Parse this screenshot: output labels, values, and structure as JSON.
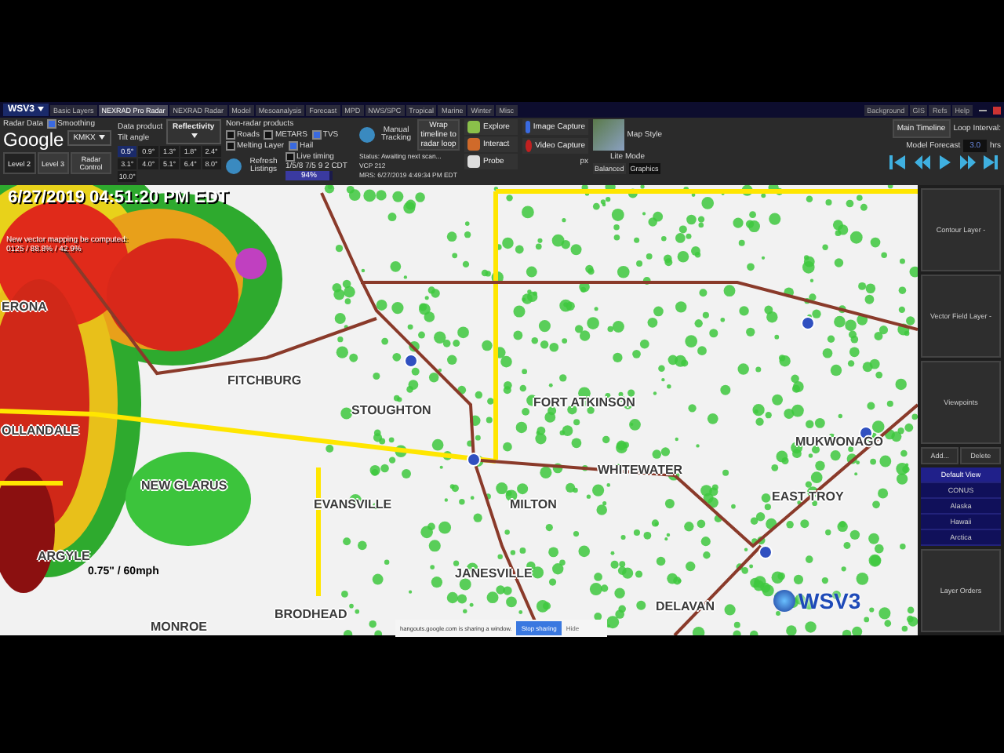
{
  "app_title": "WSV3",
  "menu_tabs": [
    {
      "label": "Basic Layers",
      "selected": false
    },
    {
      "label": "NEXRAD Pro Radar",
      "selected": true
    },
    {
      "label": "NEXRAD Radar",
      "selected": false
    },
    {
      "label": "Model",
      "selected": false
    },
    {
      "label": "Mesoanalysis",
      "selected": false
    },
    {
      "label": "Forecast",
      "selected": false
    },
    {
      "label": "MPD",
      "selected": false
    },
    {
      "label": "NWS/SPC",
      "selected": false
    },
    {
      "label": "Tropical",
      "selected": false
    },
    {
      "label": "Marine",
      "selected": false
    },
    {
      "label": "Winter",
      "selected": false
    },
    {
      "label": "Misc",
      "selected": false
    }
  ],
  "window_links": [
    "Background",
    "GIS",
    "Refs",
    "Help"
  ],
  "overlay_logo": "Google",
  "radar_panel": {
    "title": "Radar Data",
    "smoothing": {
      "label": "Smoothing",
      "checked": true
    },
    "site": "KMKX",
    "levels": [
      {
        "label": "Level 2",
        "selected": true
      },
      {
        "label": "Level 3",
        "selected": false
      }
    ],
    "control": "Radar Control"
  },
  "product_panel": {
    "data_product": "Data product",
    "tilt_label": "Tilt angle",
    "product": "Reflectivity",
    "tilts": [
      {
        "label": "0.5°",
        "selected": true
      },
      {
        "label": "0.9°",
        "selected": false
      },
      {
        "label": "1.3°",
        "selected": false
      },
      {
        "label": "1.8°",
        "selected": false
      },
      {
        "label": "2.4°",
        "selected": false
      },
      {
        "label": "3.1°",
        "selected": false
      },
      {
        "label": "4.0°",
        "selected": false
      },
      {
        "label": "5.1°",
        "selected": false
      },
      {
        "label": "6.4°",
        "selected": false
      },
      {
        "label": "8.0°",
        "selected": false
      },
      {
        "label": "10.0°",
        "selected": false
      }
    ]
  },
  "non_radar": {
    "title": "Non-radar products",
    "checks": [
      {
        "label": "Roads",
        "checked": false
      },
      {
        "label": "METARS",
        "checked": false
      },
      {
        "label": "TVS",
        "checked": true
      },
      {
        "label": "Melting Layer",
        "checked": false
      },
      {
        "label": "Hail",
        "checked": true
      }
    ]
  },
  "tracking": {
    "manual": "Manual Tracking",
    "wrap": "Wrap timeline to radar loop",
    "refresh": "Refresh Listings",
    "live": {
      "label": "Live timing",
      "checked": false
    },
    "live_time": "1/5/8 7/5 9 2 CDT",
    "progress": {
      "level": 0.94,
      "reading": "94%"
    }
  },
  "status": [
    "Status: Awaiting next scan...",
    "VCP 212",
    "MRS: 6/27/2019 4:49:34 PM EDT"
  ],
  "tools": [
    "Explore",
    "Interact",
    "Probe"
  ],
  "capture": [
    "Image Capture",
    "Video Capture"
  ],
  "px_label": "px",
  "map_style": {
    "label": "Map Style",
    "lite_mode": "Lite Mode",
    "modes": [
      {
        "label": "Balanced",
        "selected": true
      },
      {
        "label": "Graphics",
        "selected": false
      }
    ]
  },
  "timeline": {
    "main": "Main Timeline",
    "model": "Model Forecast",
    "loop_label": "Loop Interval:",
    "loop_value": "3.0",
    "loop_unit": "hrs"
  },
  "map": {
    "timestamp": "6/27/2019 04:51:20 PM EDT",
    "note": "New vector mapping be computed:",
    "note_values": "0125 / 88.8% / 42.9%",
    "hail": "0.75\" / 60mph",
    "logo": "WSV3",
    "towns": [
      "ERONA",
      "FITCHBURG",
      "STOUGHTON",
      "FORT ATKINSON",
      "OLLANDALE",
      "MUKWONAGO",
      "WHITEWATER",
      "NEW GLARUS",
      "EVANSVILLE",
      "MILTON",
      "EAST TROY",
      "ARGYLE",
      "JANESVILLE",
      "DELAVAN",
      "BRODHEAD",
      "MONROE"
    ]
  },
  "side_panel": {
    "buttons": [
      "Contour Layer -",
      "Vector Field Layer -"
    ],
    "viewpoints": "Viewpoints",
    "add": "Add...",
    "delete": "Delete",
    "views": [
      {
        "label": "Default View",
        "selected": true
      },
      {
        "label": "CONUS",
        "selected": false
      },
      {
        "label": "Alaska",
        "selected": false
      },
      {
        "label": "Hawaii",
        "selected": false
      },
      {
        "label": "Arctica",
        "selected": false
      }
    ],
    "layer_orders": "Layer Orders"
  },
  "share_bar": {
    "message": "hangouts.google.com is sharing a window.",
    "stop": "Stop sharing",
    "hide": "Hide"
  }
}
